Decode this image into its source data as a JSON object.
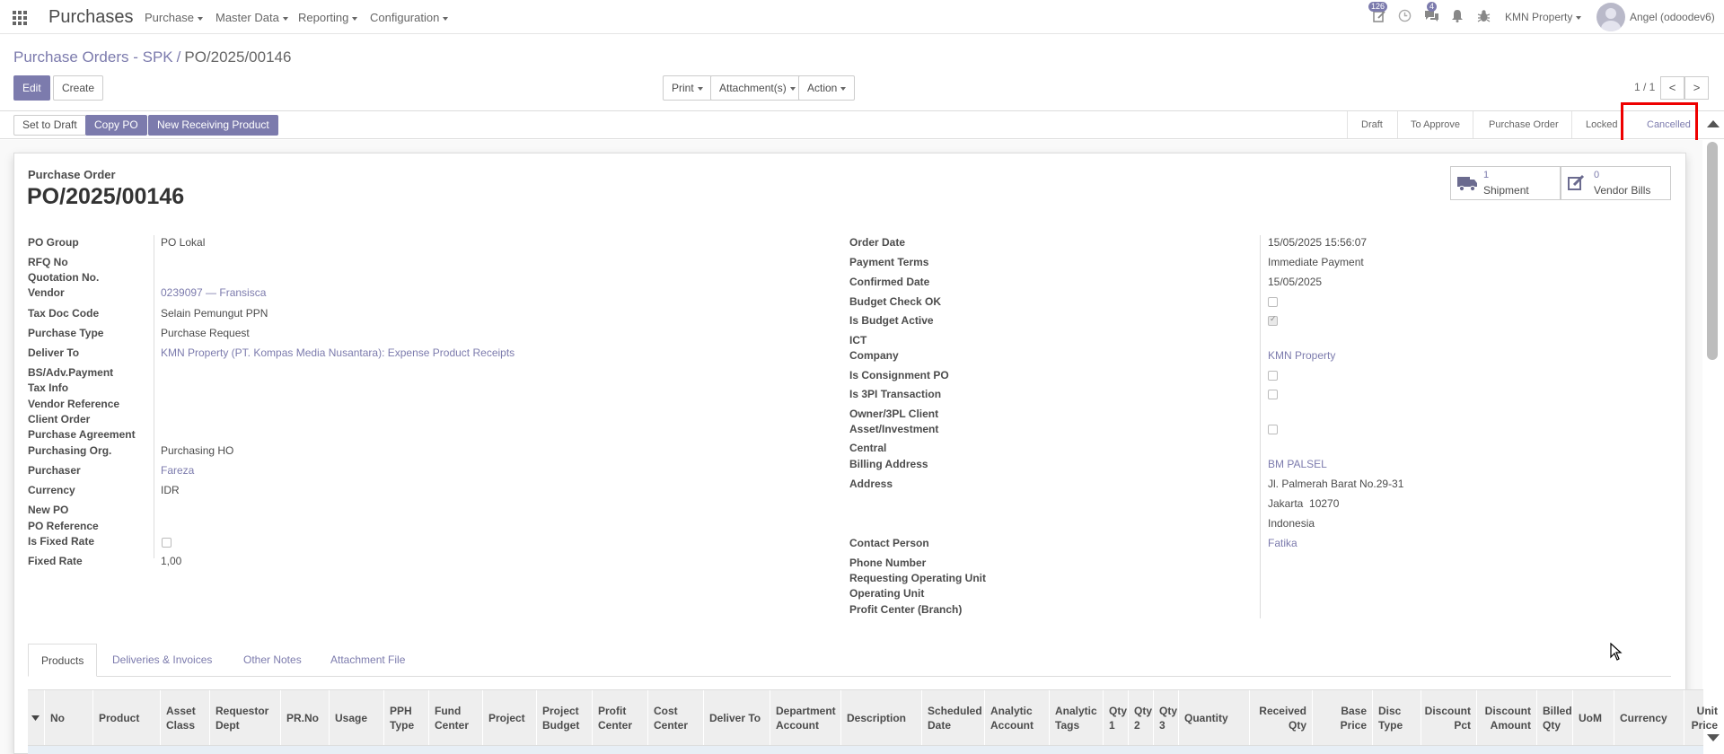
{
  "navbar": {
    "app_title": "Purchases",
    "menus": [
      "Purchase",
      "Master Data",
      "Reporting",
      "Configuration"
    ],
    "activity_count": "126",
    "messages_count": "4",
    "company": "KMN Property",
    "user": "Angel (odoodev6)"
  },
  "breadcrumb": {
    "parent": "Purchase Orders - SPK",
    "separator": "/",
    "current": "PO/2025/00146"
  },
  "control": {
    "edit": "Edit",
    "create": "Create",
    "print": "Print",
    "attachments": "Attachment(s)",
    "action": "Action",
    "pager": "1 / 1",
    "prev": "<",
    "next": ">"
  },
  "header_buttons": {
    "set_to_draft": "Set to Draft",
    "copy_po": "Copy PO",
    "new_receiving": "New Receiving Product"
  },
  "statusbar": {
    "stages": [
      "Draft",
      "To Approve",
      "Purchase Order",
      "Locked",
      "Cancelled"
    ],
    "active": "Cancelled"
  },
  "smart_buttons": {
    "shipment_count": "1",
    "shipment_label": "Shipment",
    "bills_count": "0",
    "bills_label": "Vendor Bills"
  },
  "form": {
    "type_label": "Purchase Order",
    "name": "PO/2025/00146",
    "left": {
      "po_group": {
        "label": "PO Group",
        "value": "PO Lokal"
      },
      "rfq_no": {
        "label": "RFQ No",
        "value": ""
      },
      "quotation_no": {
        "label": "Quotation No.",
        "value": ""
      },
      "vendor": {
        "label": "Vendor",
        "value": "0239097 — Fransisca"
      },
      "tax_doc_code": {
        "label": "Tax Doc Code",
        "value": "Selain Pemungut PPN"
      },
      "purchase_type": {
        "label": "Purchase Type",
        "value": "Purchase Request"
      },
      "deliver_to": {
        "label": "Deliver To",
        "value": "KMN Property (PT. Kompas Media Nusantara): Expense Product Receipts"
      },
      "bs_adv_payment": {
        "label": "BS/Adv.Payment",
        "value": ""
      },
      "tax_info": {
        "label": "Tax Info",
        "value": ""
      },
      "vendor_reference": {
        "label": "Vendor Reference",
        "value": ""
      },
      "client_order": {
        "label": "Client Order",
        "value": ""
      },
      "purchase_agreement": {
        "label": "Purchase Agreement",
        "value": ""
      },
      "purchasing_org": {
        "label": "Purchasing Org.",
        "value": "Purchasing HO"
      },
      "purchaser": {
        "label": "Purchaser",
        "value": "Fareza"
      },
      "currency": {
        "label": "Currency",
        "value": "IDR"
      },
      "new_po": {
        "label": "New PO",
        "value": ""
      },
      "po_reference": {
        "label": "PO Reference",
        "value": ""
      },
      "is_fixed_rate": {
        "label": "Is Fixed Rate",
        "checked": false
      },
      "fixed_rate": {
        "label": "Fixed Rate",
        "value": "1,00"
      }
    },
    "right": {
      "order_date": {
        "label": "Order Date",
        "value": "15/05/2025 15:56:07"
      },
      "payment_terms": {
        "label": "Payment Terms",
        "value": "Immediate Payment"
      },
      "confirmed_date": {
        "label": "Confirmed Date",
        "value": "15/05/2025"
      },
      "budget_check_ok": {
        "label": "Budget Check OK",
        "checked": false
      },
      "is_budget_active": {
        "label": "Is Budget Active",
        "checked": true
      },
      "ict": {
        "label": "ICT",
        "value": ""
      },
      "company": {
        "label": "Company",
        "value": "KMN Property"
      },
      "is_consignment_po": {
        "label": "Is Consignment PO",
        "checked": false
      },
      "is_3pl_transaction": {
        "label": "Is 3PI Transaction",
        "checked": false
      },
      "owner_3pl_client": {
        "label": "Owner/3PL Client",
        "value": ""
      },
      "asset_investment": {
        "label": "Asset/Investment",
        "checked": false
      },
      "central": {
        "label": "Central",
        "value": ""
      },
      "billing_address": {
        "label": "Billing Address",
        "value": "BM PALSEL"
      },
      "address": {
        "label": "Address",
        "line1": "Jl. Palmerah Barat No.29-31",
        "line2": "Jakarta  10270",
        "line3": "Indonesia"
      },
      "contact_person": {
        "label": "Contact Person",
        "value": "Fatika"
      },
      "phone_number": {
        "label": "Phone Number",
        "value": ""
      },
      "requesting_operating_unit": {
        "label": "Requesting Operating Unit",
        "value": ""
      },
      "operating_unit": {
        "label": "Operating Unit",
        "value": ""
      },
      "profit_center": {
        "label": "Profit Center (Branch)",
        "value": ""
      }
    }
  },
  "tabs": [
    "Products",
    "Deliveries & Invoices",
    "Other Notes",
    "Attachment File"
  ],
  "columns": [
    "No",
    "Product",
    "Asset Class",
    "Requestor Dept",
    "PR.No",
    "Usage",
    "PPH Type",
    "Fund Center",
    "Project",
    "Project Budget",
    "Profit Center",
    "Cost Center",
    "Deliver To",
    "Department Account",
    "Description",
    "Scheduled Date",
    "Analytic Account",
    "Analytic Tags",
    "Qty 1",
    "Qty 2",
    "Qty 3",
    "Quantity",
    "Received Qty",
    "Base Price",
    "Disc Type",
    "Discount Pct",
    "Discount Amount",
    "Billed Qty",
    "UoM",
    "Currency",
    "Unit Price"
  ],
  "colors": {
    "primary": "#7c7bad",
    "highlight": "#e00000"
  }
}
